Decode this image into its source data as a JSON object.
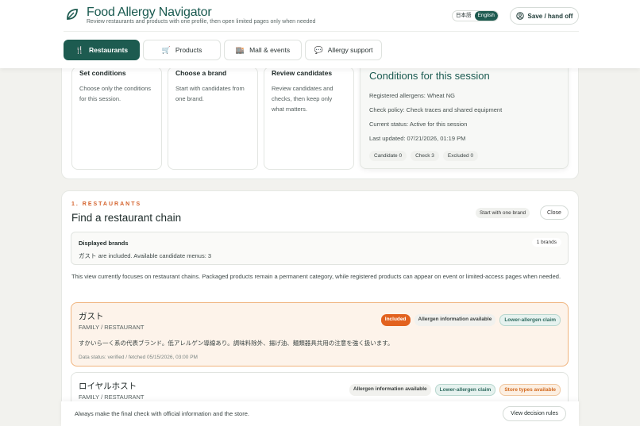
{
  "header": {
    "title": "Food Allergy Navigator",
    "subtitle": "Review restaurants and products with one profile, then open limited pages only when needed",
    "lang": [
      "日本語",
      "English"
    ],
    "lang_active": "English",
    "save_label": "Save / hand off",
    "logo_icon": "leaf-logo-icon"
  },
  "tabs": [
    {
      "label": "Restaurants",
      "icon": "fork-knife-icon",
      "active": true
    },
    {
      "label": "Products",
      "icon": "cart-icon",
      "active": false
    },
    {
      "label": "Mall & events",
      "icon": "store-icon",
      "active": false
    },
    {
      "label": "Allergy support",
      "icon": "chat-icon",
      "active": false
    }
  ],
  "steps": [
    {
      "title": "Set conditions",
      "desc": "Choose only the conditions for this session."
    },
    {
      "title": "Choose a brand",
      "desc": "Start with candidates from one brand."
    },
    {
      "title": "Review candidates",
      "desc": "Review candidates and checks, then keep only what matters."
    }
  ],
  "conditions": {
    "title": "Conditions for this session",
    "allergens": "Registered allergens: Wheat NG",
    "policy": "Check policy: Check traces and shared equipment",
    "status": "Current status: Active for this session",
    "updated": "Last updated: 07/21/2026, 01:19 PM",
    "chips": [
      "Candidate 0",
      "Check 3",
      "Excluded 0"
    ]
  },
  "section": {
    "kicker": "1. RESTAURANTS",
    "title": "Find a restaurant chain",
    "start_chip": "Start with one brand",
    "close_label": "Close"
  },
  "displayed": {
    "title": "Displayed brands",
    "desc": "ガスト are included. Available candidate menus: 3",
    "count": "1 brands"
  },
  "focus_note": "This view currently focuses on restaurant chains. Packaged products remain a permanent category, while registered products can appear on event or limited-access pages when needed.",
  "items": [
    {
      "name": "ガスト",
      "category": "FAMILY / RESTAURANT",
      "desc": "すかいら一く系の代表ブランド。低アレルゲン導線あり。調味料除外、揚げ油、麺類器具共用の注意を強く扱います。",
      "status": "Data status: verified / fetched 05/15/2026, 03:00 PM",
      "badges": [
        "Included",
        "Allergen information available",
        "Lower-allergen claim"
      ]
    },
    {
      "name": "ロイヤルホスト",
      "category": "FAMILY / RESTAURANT",
      "badges": [
        "Allergen information available",
        "Lower-allergen claim",
        "Store types available"
      ]
    }
  ],
  "footer": {
    "note": "Always make the final check with official information and the store.",
    "rules_label": "View decision rules"
  },
  "colors": {
    "brand": "#1d5b50",
    "accent": "#e2621f",
    "background": "#f2f2ee"
  }
}
